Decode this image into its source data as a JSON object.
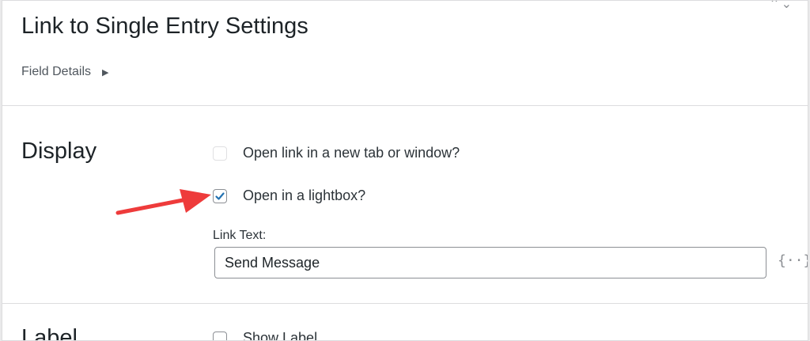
{
  "dialog": {
    "title": "Link to Single Entry Settings",
    "details_toggle": "Field Details",
    "corner_glyph": "⌃⌄"
  },
  "display_section": {
    "heading": "Display",
    "options": [
      {
        "label": "Open link in a new tab or window?",
        "checked": false
      },
      {
        "label": "Open in a lightbox?",
        "checked": true
      }
    ],
    "link_text": {
      "label": "Link Text:",
      "value": "Send Message",
      "merge_tag_glyph": "{··}"
    }
  },
  "label_section": {
    "heading": "Label",
    "options": [
      {
        "label": "Show Label",
        "checked": false
      }
    ]
  },
  "icons": {
    "details_toggle": "triangle-right-icon",
    "merge_tag": "merge-tag-icon",
    "annotation": "red-arrow"
  },
  "colors": {
    "checkbox_check": "#2271b1",
    "annotation_arrow": "#ee3b3b",
    "text": "#1d2327"
  }
}
